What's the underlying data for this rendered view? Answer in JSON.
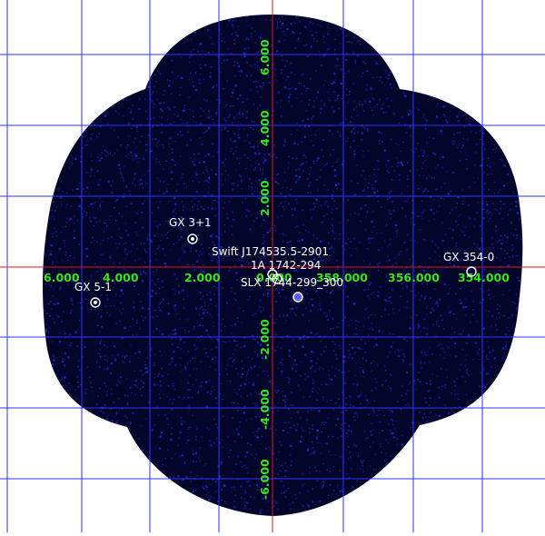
{
  "image": {
    "background": "#ffffff",
    "field_color": "#04052a",
    "noise_color": "#1d2cd6",
    "grid_color": "#2e34ff",
    "axis_color": "#e0161a",
    "tick_label_color": "#35e619",
    "source_label_color": "#ffffff"
  },
  "axes": {
    "lon_ticks": [
      "6.000",
      "4.000",
      "2.000",
      "0.000",
      "358.000",
      "356.000",
      "354.000"
    ],
    "lat_ticks": [
      "6.000",
      "4.000",
      "2.000",
      "-2.000",
      "-4.000",
      "-6.000"
    ]
  },
  "sources": [
    {
      "name": "GX 3+1"
    },
    {
      "name": "GX 354-0"
    },
    {
      "name": "GX 5-1"
    },
    {
      "name": "Swift J174535.5-2901"
    },
    {
      "name": "1A 1742-294"
    },
    {
      "name": "SLX 1744-299_300"
    }
  ]
}
